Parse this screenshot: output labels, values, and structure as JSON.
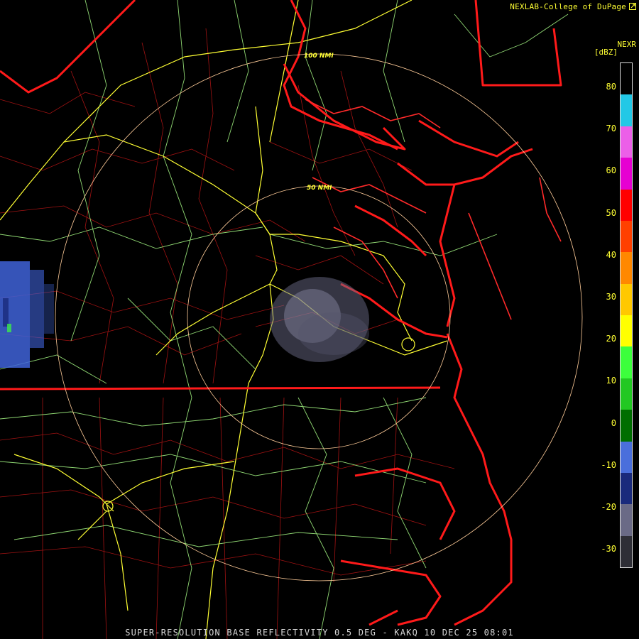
{
  "header": {
    "credit": "NEXLAB-College of DuPage",
    "credit_icon": "external-link-icon",
    "product": "NEXR",
    "units": "[dBZ]"
  },
  "rings": [
    {
      "label": "100 NMI"
    },
    {
      "label": "50 NMI"
    }
  ],
  "scale": {
    "ticks": [
      "80",
      "70",
      "60",
      "50",
      "40",
      "30",
      "20",
      "10",
      "0",
      "-10",
      "-20",
      "-30"
    ],
    "colors": [
      "#000000",
      "#22c8e6",
      "#ec5fe8",
      "#e600d2",
      "#ff0000",
      "#ff4000",
      "#ff8800",
      "#ffc800",
      "#ffff00",
      "#3cff3c",
      "#22c822",
      "#006e00",
      "#4a6fdc",
      "#1a2a7c",
      "#6a6a86",
      "#2e2e36"
    ]
  },
  "footer": {
    "text": "SUPER-RESOLUTION BASE REFLECTIVITY 0.5 DEG - KAKQ 10 DEC 25 08:01"
  },
  "colors": {
    "state_border": "#ff1a1a",
    "county_border": "#cc1a1a",
    "interstate": "#ffff33",
    "highway": "#aaff88",
    "range_ring": "#ffcc99",
    "weak_echo": "#6a6a86",
    "light_echo": "#3f63d8"
  }
}
